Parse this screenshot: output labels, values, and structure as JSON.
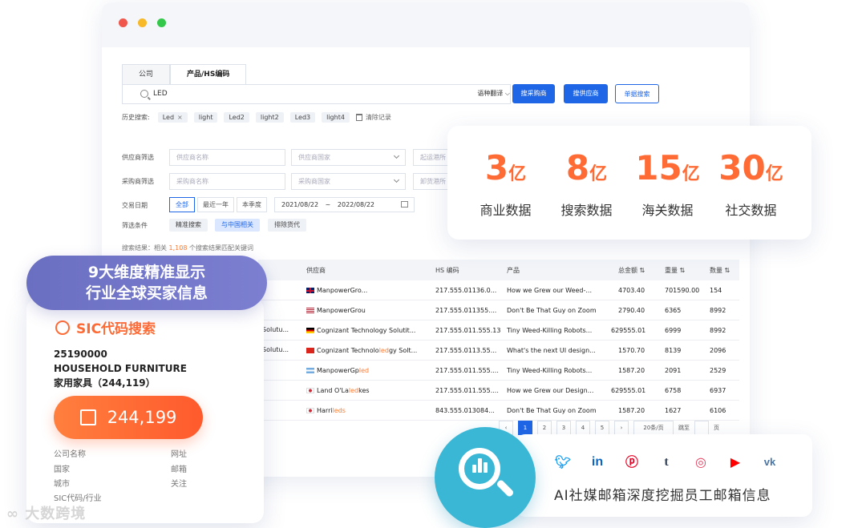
{
  "window": {
    "tabs": [
      {
        "label": "公司"
      },
      {
        "label": "产品/HS编码"
      }
    ],
    "search": {
      "value": "LED",
      "lang": "语种翻译"
    },
    "buttons": {
      "buyer": "搜采购商",
      "supplier": "搜供应商",
      "bill": "单据搜索"
    },
    "history": {
      "label": "历史搜索:",
      "chips": [
        "Led",
        "light",
        "Led2",
        "light2",
        "Led3",
        "light4"
      ],
      "clear": "清除记录"
    },
    "filters": {
      "supplier_label": "供应商筛选",
      "supplier_name_ph": "供应商名称",
      "supplier_country_ph": "供应商国家",
      "origin_port_ph": "起运港所",
      "buyer_label": "采购商筛选",
      "buyer_name_ph": "采购商名称",
      "buyer_country_ph": "采购商国家",
      "dest_port_ph": "卸货港所",
      "date_label": "交易日期",
      "date_ranges": [
        "全部",
        "最近一年",
        "本季度"
      ],
      "date_from": "2021/08/22",
      "date_sep": "~",
      "date_to": "2022/08/22",
      "cond_label": "筛选条件",
      "conditions": [
        "精准搜索",
        "与中国相关",
        "排除货代"
      ]
    },
    "result": {
      "prefix": "搜索结果：相关",
      "count": "1,108",
      "suffix": "个搜索结果匹配关键词"
    },
    "table": {
      "headers": [
        "供应商",
        "HS 编码",
        "产品",
        "总金额",
        "重量",
        "数量"
      ],
      "left_fragments": [
        "Solutu...",
        "Solutu..."
      ],
      "rows": [
        {
          "flag": "uk",
          "supplier": "ManpowerGro...",
          "hs": "217.555.01136.0...",
          "product": "How we Grew our Weed-...",
          "amount": "4703.40",
          "weight": "701590.00",
          "qty": "154"
        },
        {
          "flag": "us",
          "supplier": "ManpowerGrou",
          "hs": "217.555.011355....",
          "product": "Don't Be That Guy on Zoom",
          "amount": "2790.40",
          "weight": "6365",
          "qty": "8992"
        },
        {
          "flag": "de",
          "supplier": "Cognizant Technology Solutit...",
          "hs": "217.555.011.555.13",
          "product": "Tiny Weed-Killing Robots...",
          "amount": "629555.01",
          "weight": "6999",
          "qty": "8992"
        },
        {
          "flag": "vn",
          "supplier_a": "Cognizant Technolo",
          "supplier_hl": "led",
          "supplier_b": "gy Solt...",
          "hs": "217.555.0113.55...",
          "product": "What's the next UI design...",
          "amount": "1570.70",
          "weight": "8139",
          "qty": "2096"
        },
        {
          "flag": "ar",
          "supplier_a": "ManpowerGp",
          "supplier_hl": "led",
          "supplier_b": "",
          "hs": "217.555.011.555....",
          "product": "Tiny Weed-Killing Robots...",
          "amount": "1587.20",
          "weight": "2091",
          "qty": "2529"
        },
        {
          "flag": "kr",
          "supplier_a": "Land O'La",
          "supplier_hl": "led",
          "supplier_b": "kes",
          "hs": "217.555.011.555....",
          "product": "How we Grew our Design...",
          "amount": "629555.01",
          "weight": "6758",
          "qty": "6937"
        },
        {
          "flag": "kr",
          "supplier_a": "Harri",
          "supplier_hl": "leds",
          "supplier_b": "",
          "hs": "843.555.013084...",
          "product": "Don't Be That Guy on Zoom",
          "amount": "1587.20",
          "weight": "1627",
          "qty": "6106"
        }
      ]
    },
    "pager": {
      "prev": "‹",
      "pages": [
        "1",
        "2",
        "3",
        "4",
        "5"
      ],
      "next": "›",
      "per_page": "20条/页",
      "jump": "跳至",
      "page_unit": "页"
    }
  },
  "stats": [
    {
      "num": "3",
      "unit": "亿",
      "label": "商业数据"
    },
    {
      "num": "8",
      "unit": "亿",
      "label": "搜索数据"
    },
    {
      "num": "15",
      "unit": "亿",
      "label": "海关数据"
    },
    {
      "num": "30",
      "unit": "亿",
      "label": "社交数据"
    }
  ],
  "banner": {
    "line1": "9大维度精准显示",
    "line2": "行业全球买家信息"
  },
  "sic": {
    "title": "SIC代码搜索",
    "code": "25190000",
    "name_en": "HOUSEHOLD FURNITURE",
    "name_cn": "家用家具（244,119）",
    "count": "244,199",
    "fields": [
      "公司名称",
      "网址",
      "国家",
      "邮箱",
      "城市",
      "关注",
      "SIC代码/行业"
    ]
  },
  "social": {
    "text": "AI社媒邮箱深度挖掘员工邮箱信息"
  },
  "watermark": "大数跨境",
  "colors": {
    "accent": "#ff6b35",
    "primary": "#1f66e6",
    "purple": "#6b6fc2",
    "teal": "#3bb7d6"
  }
}
